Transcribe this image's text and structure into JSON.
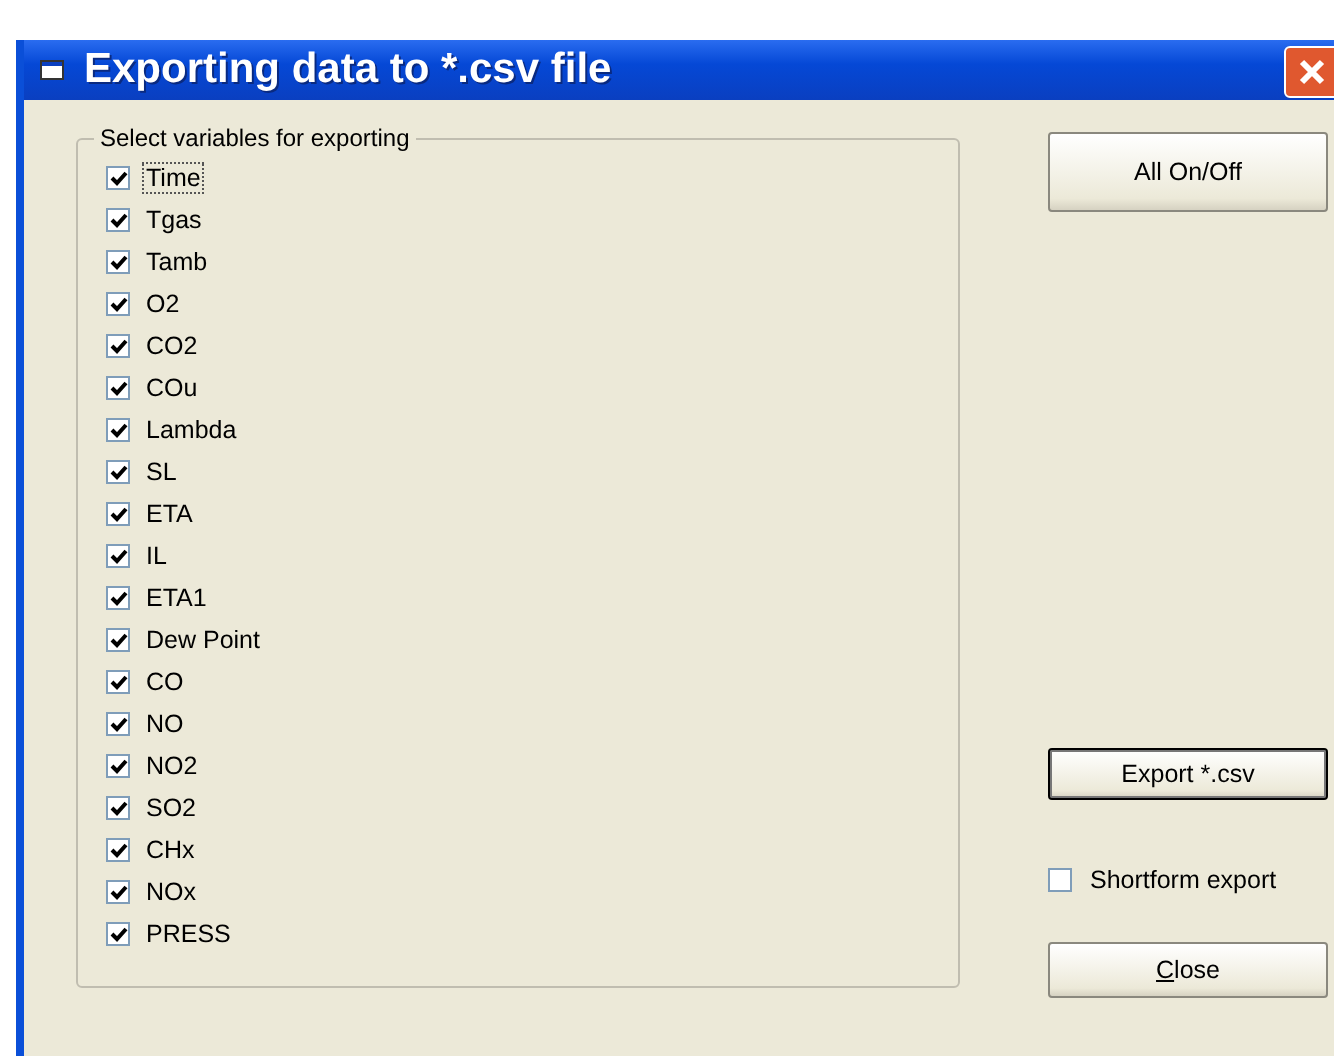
{
  "window": {
    "title": "Exporting data to *.csv file"
  },
  "group": {
    "title": "Select variables for exporting",
    "variables": [
      {
        "label": "Time",
        "checked": true,
        "focused": true
      },
      {
        "label": "Tgas",
        "checked": true,
        "focused": false
      },
      {
        "label": "Tamb",
        "checked": true,
        "focused": false
      },
      {
        "label": "O2",
        "checked": true,
        "focused": false
      },
      {
        "label": "CO2",
        "checked": true,
        "focused": false
      },
      {
        "label": "COu",
        "checked": true,
        "focused": false
      },
      {
        "label": "Lambda",
        "checked": true,
        "focused": false
      },
      {
        "label": "SL",
        "checked": true,
        "focused": false
      },
      {
        "label": "ETA",
        "checked": true,
        "focused": false
      },
      {
        "label": "IL",
        "checked": true,
        "focused": false
      },
      {
        "label": "ETA1",
        "checked": true,
        "focused": false
      },
      {
        "label": "Dew Point",
        "checked": true,
        "focused": false
      },
      {
        "label": "CO",
        "checked": true,
        "focused": false
      },
      {
        "label": "NO",
        "checked": true,
        "focused": false
      },
      {
        "label": "NO2",
        "checked": true,
        "focused": false
      },
      {
        "label": "SO2",
        "checked": true,
        "focused": false
      },
      {
        "label": "CHx",
        "checked": true,
        "focused": false
      },
      {
        "label": "NOx",
        "checked": true,
        "focused": false
      },
      {
        "label": "PRESS",
        "checked": true,
        "focused": false
      }
    ]
  },
  "all_button": {
    "label": "All On/Off"
  },
  "export_button": {
    "label": "Export *.csv",
    "default": true
  },
  "shortform": {
    "label": "Shortform export",
    "checked": false
  },
  "close_button": {
    "label": "Close",
    "mnemonic_first": true
  }
}
